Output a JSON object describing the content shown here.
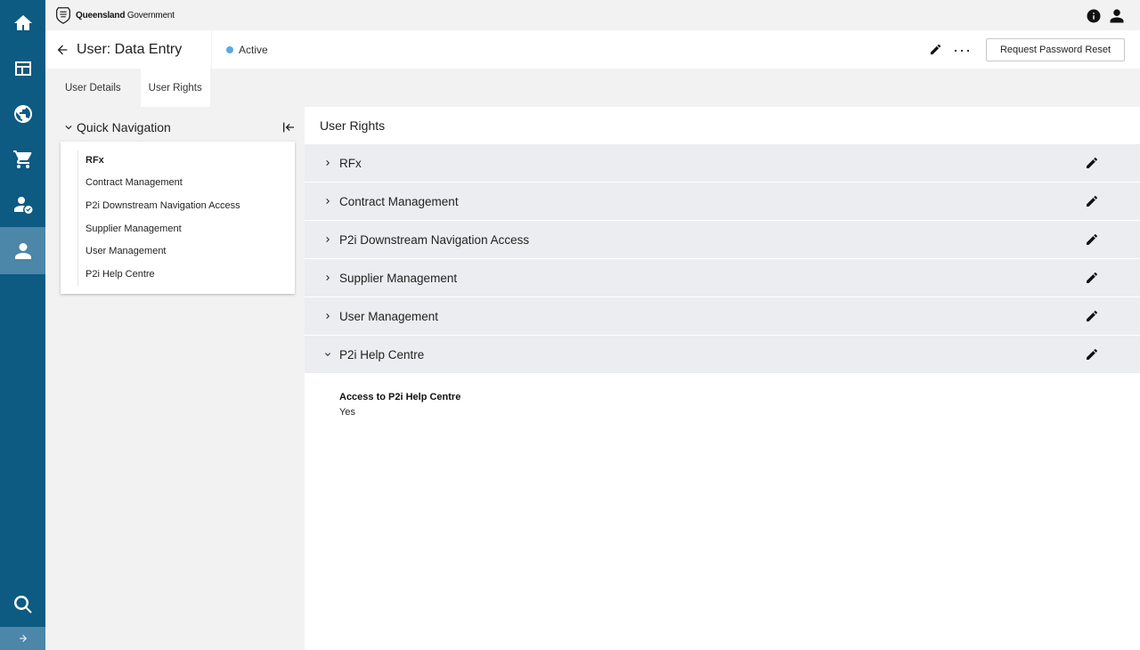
{
  "brand": {
    "name_bold": "Queensland",
    "name_regular": "Government"
  },
  "sidebar": {
    "items": [
      {
        "icon": "home-icon"
      },
      {
        "icon": "dashboard-icon"
      },
      {
        "icon": "globe-icon"
      },
      {
        "icon": "cart-icon"
      },
      {
        "icon": "user-check-icon"
      },
      {
        "icon": "user-icon",
        "active": true
      },
      {
        "icon": "search-icon"
      }
    ],
    "expand_icon": "arrow-right-icon"
  },
  "header": {
    "title": "User: Data Entry",
    "status": "Active",
    "status_color": "#5ba8e8",
    "reset_button": "Request Password Reset"
  },
  "tabs": [
    {
      "label": "User Details",
      "active": false
    },
    {
      "label": "User Rights",
      "active": true
    }
  ],
  "quick_nav": {
    "title": "Quick Navigation",
    "items": [
      {
        "label": "RFx",
        "active": true
      },
      {
        "label": "Contract Management",
        "active": false
      },
      {
        "label": "P2i Downstream Navigation Access",
        "active": false
      },
      {
        "label": "Supplier Management",
        "active": false
      },
      {
        "label": "User Management",
        "active": false
      },
      {
        "label": "P2i Help Centre",
        "active": false
      }
    ]
  },
  "main": {
    "title": "User Rights",
    "sections": [
      {
        "label": "RFx",
        "expanded": false
      },
      {
        "label": "Contract Management",
        "expanded": false
      },
      {
        "label": "P2i Downstream Navigation Access",
        "expanded": false
      },
      {
        "label": "Supplier Management",
        "expanded": false
      },
      {
        "label": "User Management",
        "expanded": false
      },
      {
        "label": "P2i Help Centre",
        "expanded": true
      }
    ],
    "detail": {
      "label": "Access to P2i Help Centre",
      "value": "Yes"
    }
  },
  "colors": {
    "sidebar": "#0d5a82",
    "sidebar_active": "#4c86a8",
    "accordion": "#ecedf0",
    "page_bg": "#f2f2f2"
  }
}
